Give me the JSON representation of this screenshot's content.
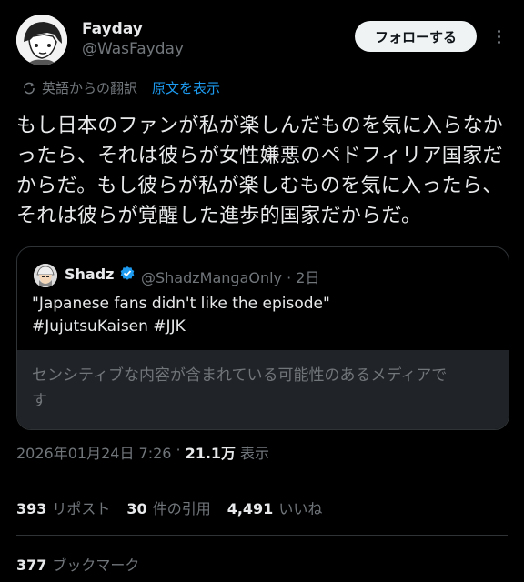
{
  "author": {
    "name": "Fayday",
    "handle": "@WasFayday",
    "avatar_icon": "manga-avatar"
  },
  "follow_button": "フォローする",
  "more_icon": "more-icon",
  "translation": {
    "label": "英語からの翻訳",
    "link": "原文を表示",
    "icon": "translate-icon"
  },
  "body": "もし日本のファンが私が楽しんだものを気に入らなか\nったら、それは彼らが女性嫌悪のペドフィリア国家だ\nからだ。もし彼らが私が楽しむものを気に入ったら、\nそれは彼らが覚醒した進歩的国家だからだ。",
  "quote": {
    "name": "Shadz",
    "verified_icon": "verified-badge-icon",
    "handle": "@ShadzMangaOnly",
    "separator": "·",
    "time": "2日",
    "text": "\"Japanese fans didn't like the episode\"\n#JujutsuKaisen #JJK",
    "sensitive": "センシティブな内容が含まれている可能性のあるメディアで\nす"
  },
  "meta": {
    "datetime": "2026年01月24日 7:26",
    "sep": "·",
    "views": "21.1万",
    "views_label": "表示"
  },
  "stats": {
    "reposts": "393",
    "reposts_label": "リポスト",
    "quotes": "30",
    "quotes_label": "件の引用",
    "likes": "4,491",
    "likes_label": "いいね",
    "bookmarks": "377",
    "bookmarks_label": "ブックマーク"
  },
  "colors": {
    "background": "#000000",
    "link": "#1d9bf0",
    "verified": "#1d9bf0",
    "muted": "#71767b"
  }
}
